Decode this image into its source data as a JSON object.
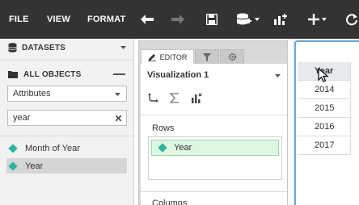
{
  "menu": {
    "file": "FILE",
    "view": "VIEW",
    "format": "FORMAT"
  },
  "toolbar_icons": [
    "undo-icon",
    "redo-icon",
    "save-icon",
    "add-dataset-icon",
    "add-visualization-icon",
    "insert-icon",
    "refresh-icon"
  ],
  "datasets": {
    "header": "DATASETS"
  },
  "objects": {
    "header": "ALL OBJECTS",
    "filter_selected": "Attributes",
    "search_value": "year",
    "items": [
      {
        "label": "Month of Year"
      },
      {
        "label": "Year"
      }
    ]
  },
  "editor": {
    "tab_editor": "EDITOR",
    "viz_title": "Visualization 1",
    "rows_label": "Rows",
    "rows_items": [
      "Year"
    ],
    "columns_label": "Columns"
  },
  "grid": {
    "header": "Year",
    "rows": [
      "2014",
      "2015",
      "2016",
      "2017"
    ]
  },
  "colors": {
    "toolbar_bg": "#333333",
    "attribute_diamond": "#2bb5a1",
    "chip_bg": "#def7e2",
    "selection_border": "#6aa9d6"
  }
}
